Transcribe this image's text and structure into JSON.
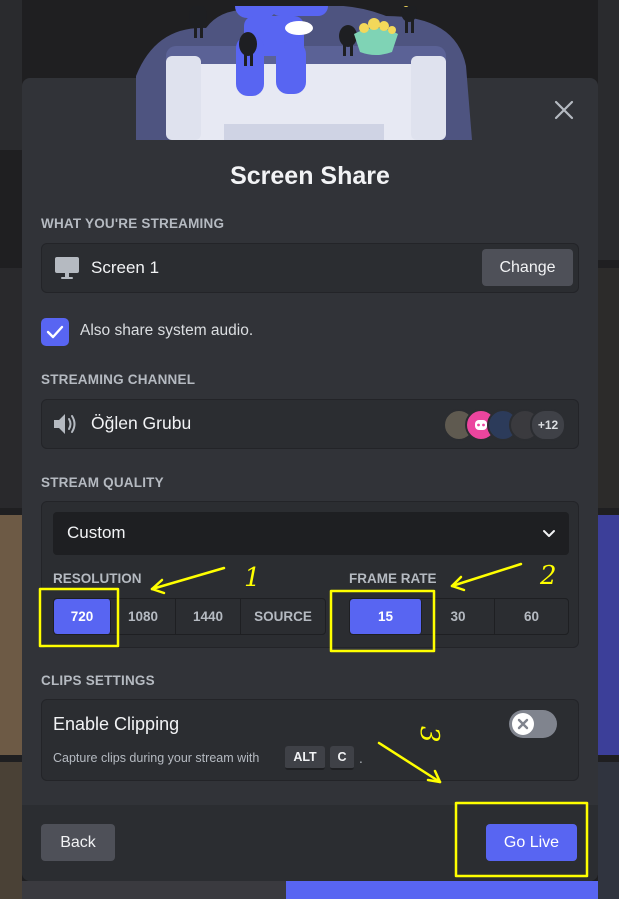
{
  "modal": {
    "title": "Screen Share",
    "close_icon": "close-icon"
  },
  "streaming": {
    "label": "WHAT YOU'RE STREAMING",
    "source_name": "Screen 1",
    "source_icon": "monitor-icon",
    "change_label": "Change"
  },
  "audio": {
    "checked": true,
    "label": "Also share system audio."
  },
  "channel": {
    "label": "STREAMING CHANNEL",
    "name": "Öğlen Grubu",
    "icon": "speaker-icon",
    "extra_count": "+12"
  },
  "quality": {
    "label": "STREAM QUALITY",
    "preset": "Custom",
    "resolution_label": "RESOLUTION",
    "resolution_options": [
      "720",
      "1080",
      "1440",
      "SOURCE"
    ],
    "resolution_selected": "720",
    "framerate_label": "FRAME RATE",
    "framerate_options": [
      "15",
      "30",
      "60"
    ],
    "framerate_selected": "15"
  },
  "clips": {
    "label": "CLIPS SETTINGS",
    "title": "Enable Clipping",
    "description": "Capture clips during your stream with",
    "key1": "ALT",
    "key2": "C",
    "trailing": ".",
    "enabled": false
  },
  "footer": {
    "back_label": "Back",
    "golive_label": "Go Live"
  },
  "annotations": {
    "label1": "1",
    "label2": "2",
    "label3": "3",
    "color": "#ffff00"
  },
  "colors": {
    "accent": "#5865f2",
    "modal_bg": "#313338",
    "panel_bg": "#2b2d31"
  }
}
